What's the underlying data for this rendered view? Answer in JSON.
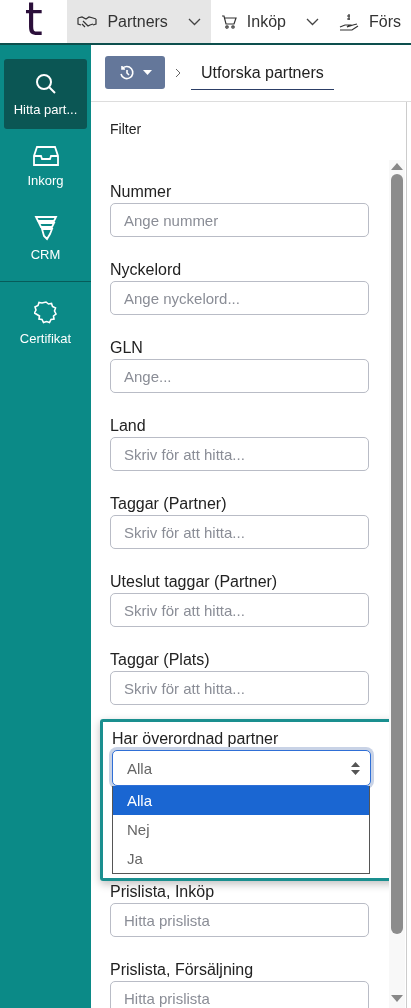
{
  "logo": {
    "text": "t"
  },
  "nav_tabs": [
    {
      "kind": "menu",
      "label": "Partners",
      "selected": true
    },
    {
      "kind": "menu",
      "label": "Inköp",
      "selected": false
    },
    {
      "kind": "link",
      "label": "Förs",
      "selected": false
    }
  ],
  "sidebar": {
    "groups": [
      {
        "items": [
          {
            "label": "Hitta part...",
            "selected": true
          },
          {
            "label": "Inkorg",
            "selected": false
          },
          {
            "label": "CRM",
            "selected": false
          }
        ]
      },
      {
        "items": [
          {
            "label": "Certifikat",
            "selected": false
          }
        ]
      }
    ]
  },
  "breadcrumb": {
    "current": "Utforska partners"
  },
  "filter": {
    "title": "Filter",
    "fields": [
      {
        "kind": "text",
        "label": "Nummer",
        "placeholder": "Ange nummer"
      },
      {
        "kind": "text",
        "label": "Nyckelord",
        "placeholder": "Ange nyckelord..."
      },
      {
        "kind": "text",
        "label": "GLN",
        "placeholder": "Ange..."
      },
      {
        "kind": "text",
        "label": "Land",
        "placeholder": "Skriv för att hitta..."
      },
      {
        "kind": "text",
        "label": "Taggar (Partner)",
        "placeholder": "Skriv för att hitta..."
      },
      {
        "kind": "text",
        "label": "Uteslut taggar (Partner)",
        "placeholder": "Skriv för att hitta..."
      },
      {
        "kind": "text",
        "label": "Taggar (Plats)",
        "placeholder": "Skriv för att hitta..."
      },
      {
        "kind": "select",
        "label": "Har överordnad partner",
        "value": "Alla",
        "expanded": true,
        "options": [
          {
            "label": "Alla",
            "selected": true
          },
          {
            "label": "Nej",
            "selected": false
          },
          {
            "label": "Ja",
            "selected": false
          }
        ]
      },
      {
        "kind": "text",
        "label": "Prislista, Inköp",
        "placeholder": "Hitta prislista"
      },
      {
        "kind": "text",
        "label": "Prislista, Försäljning",
        "placeholder": "Hitta prislista"
      }
    ]
  }
}
